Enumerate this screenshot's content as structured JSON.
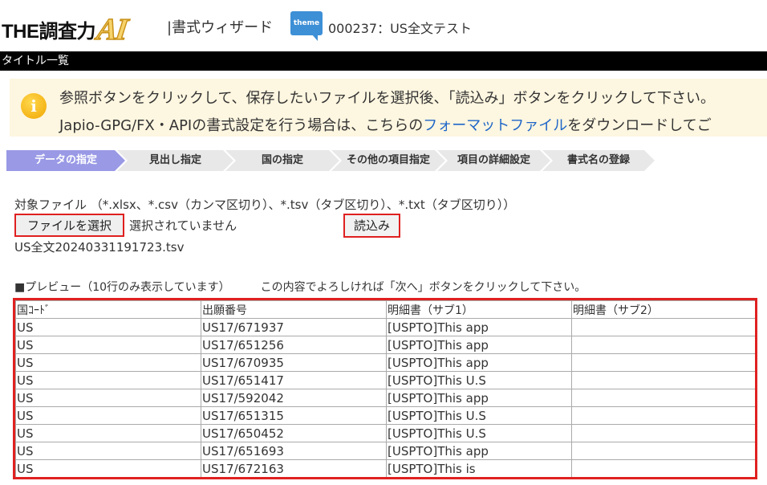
{
  "header": {
    "logo_text": "THE調査力",
    "logo_ai": "AI",
    "wizard_title": "|書式ウィザード",
    "theme_icon_label": "theme",
    "theme_name": "000237：US全文テスト"
  },
  "title_bar": "タイトル一覧",
  "info": {
    "line1": "参照ボタンをクリックして、保存したいファイルを選択後、「読込み」ボタンをクリックして下さい。",
    "line2_pre": "Japio-GPG/FX・APIの書式設定を行う場合は、こちらの",
    "line2_link": "フォーマットファイル",
    "line2_post": "をダウンロードしてご"
  },
  "steps": [
    {
      "label": "データの指定",
      "active": true
    },
    {
      "label": "見出し指定",
      "active": false
    },
    {
      "label": "国の指定",
      "active": false
    },
    {
      "label": "その他の項目指定",
      "active": false
    },
    {
      "label": "項目の詳細設定",
      "active": false
    },
    {
      "label": "書式名の登録",
      "active": false
    }
  ],
  "file_section": {
    "file_types": "対象ファイル （*.xlsx、*.csv（カンマ区切り）、*.tsv（タブ区切り）、*.txt（タブ区切り））",
    "choose_button": "ファイルを選択",
    "no_file_text": "選択されていません",
    "load_button": "読込み",
    "file_name": "US全文20240331191723.tsv"
  },
  "preview": {
    "label": "■プレビュー（10行のみ表示しています）",
    "message": "この内容でよろしければ「次へ」ボタンをクリックして下さい。",
    "columns": [
      "国ｺｰﾄﾞ",
      "出願番号",
      "明細書（サブ1）",
      "明細書（サブ2）"
    ],
    "rows": [
      [
        "US",
        "US17/671937",
        "[USPTO]This app",
        ""
      ],
      [
        "US",
        "US17/651256",
        "[USPTO]This app",
        ""
      ],
      [
        "US",
        "US17/670935",
        "[USPTO]This app",
        ""
      ],
      [
        "US",
        "US17/651417",
        "[USPTO]This U.S",
        ""
      ],
      [
        "US",
        "US17/592042",
        "[USPTO]This app",
        ""
      ],
      [
        "US",
        "US17/651315",
        "[USPTO]This U.S",
        ""
      ],
      [
        "US",
        "US17/650452",
        "[USPTO]This U.S",
        ""
      ],
      [
        "US",
        "US17/651693",
        "[USPTO]This app",
        ""
      ],
      [
        "US",
        "US17/672163",
        "[USPTO]This is",
        ""
      ]
    ]
  },
  "colors": {
    "accent_step": "#9999e6",
    "highlight_border": "#e02020",
    "info_bg": "#fdf6e0",
    "link": "#1e66c8"
  }
}
